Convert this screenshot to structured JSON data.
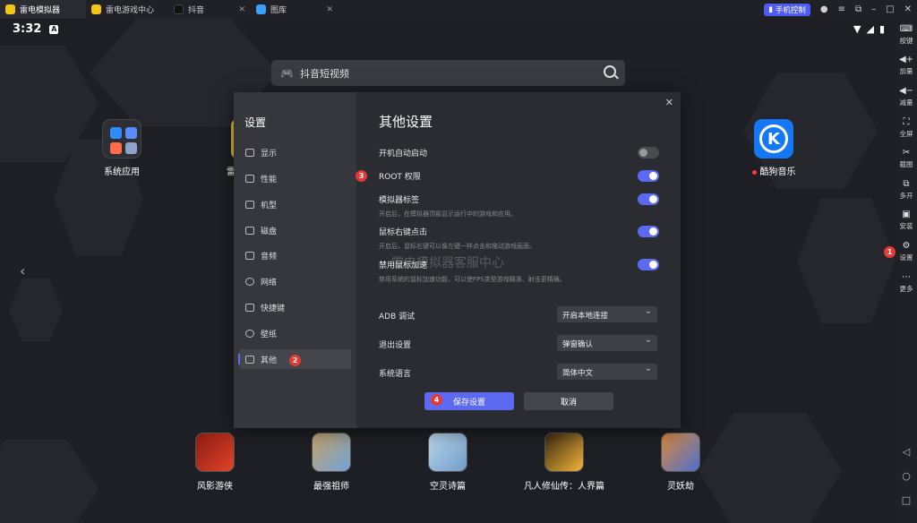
{
  "titlebar": {
    "tabs": [
      {
        "label": "雷电模拟器",
        "color": "#f5c518"
      },
      {
        "label": "雷电游戏中心",
        "color": "#f5c518"
      },
      {
        "label": "抖音",
        "color": "#111111"
      },
      {
        "label": "图库",
        "color": "#3ba0ff"
      }
    ],
    "phone_control": "手机控制"
  },
  "status": {
    "time": "3:32",
    "badge": "A"
  },
  "search": {
    "placeholder": "抖音短视频"
  },
  "desktop": {
    "apps": [
      {
        "label": "系统应用"
      },
      {
        "label": "雷"
      },
      {
        "label": "酷狗音乐"
      }
    ],
    "games": [
      "风影游侠",
      "最强祖师",
      "空灵诗篇",
      "凡人修仙传：人界篇",
      "灵妖劫"
    ]
  },
  "toolbar": {
    "items": [
      "按键",
      "加量",
      "减量",
      "全屏",
      "截图",
      "多开",
      "安装",
      "设置",
      "更多"
    ]
  },
  "dialog": {
    "title": "设置",
    "heading": "其他设置",
    "sidebar": [
      "显示",
      "性能",
      "机型",
      "磁盘",
      "音频",
      "网络",
      "快捷键",
      "壁纸",
      "其他"
    ],
    "toggles": [
      {
        "label": "开机自动启动",
        "desc": "",
        "on": false
      },
      {
        "label": "ROOT 权限",
        "desc": "",
        "on": true
      },
      {
        "label": "模拟器标签",
        "desc": "开启后，在模拟器顶部显示运行中的游戏和应用。",
        "on": true
      },
      {
        "label": "鼠标右键点击",
        "desc": "开启后，鼠标右键可以像左键一样点击和拖动游戏画面。",
        "on": true
      },
      {
        "label": "禁用鼠标加速",
        "desc": "禁用系统的鼠标加速功能，可以使FPS类型游戏瞄准、射击更精确。",
        "on": true
      }
    ],
    "selects": [
      {
        "label": "ADB 调试",
        "value": "开启本地连接"
      },
      {
        "label": "退出设置",
        "value": "弹窗确认"
      },
      {
        "label": "系统语言",
        "value": "简体中文"
      }
    ],
    "save": "保存设置",
    "cancel": "取消",
    "watermark": "雷电模拟器客服中心"
  },
  "markers": [
    "1",
    "2",
    "3",
    "4"
  ],
  "colors": {
    "accent": "#5b6af0",
    "marker": "#e53935"
  }
}
